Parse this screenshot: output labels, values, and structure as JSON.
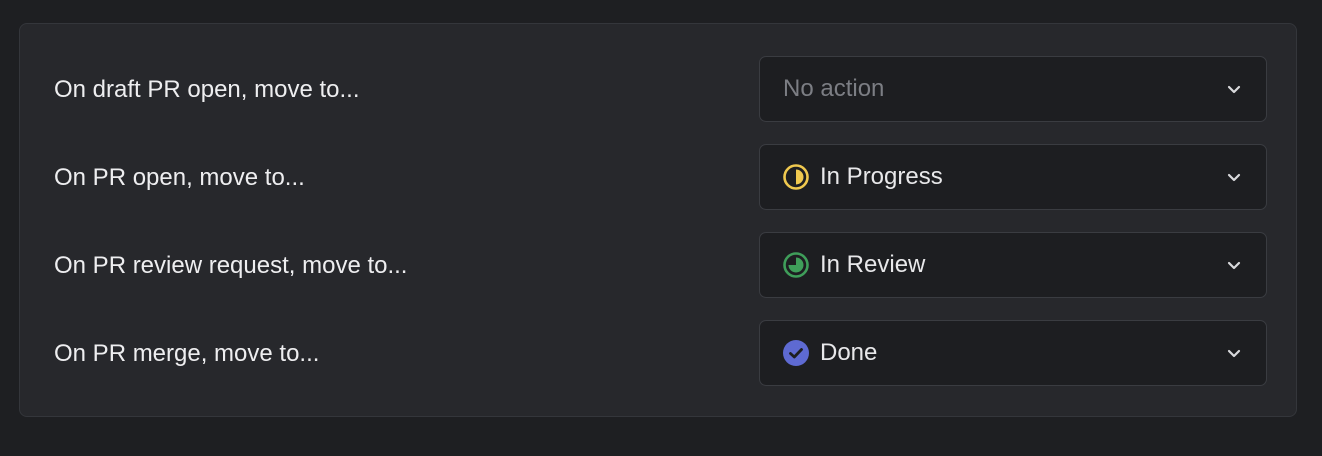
{
  "rules": [
    {
      "label": "On draft PR open, move to...",
      "value": "No action",
      "placeholder": true,
      "icon": "none"
    },
    {
      "label": "On PR open, move to...",
      "value": "In Progress",
      "placeholder": false,
      "icon": "in-progress-icon",
      "icon_color": "#f0c94f"
    },
    {
      "label": "On PR review request, move to...",
      "value": "In Review",
      "placeholder": false,
      "icon": "in-review-icon",
      "icon_color": "#3f9e5a"
    },
    {
      "label": "On PR merge, move to...",
      "value": "Done",
      "placeholder": false,
      "icon": "done-icon",
      "icon_color": "#5e6ad2"
    }
  ],
  "colors": {
    "background": "#1e1f22",
    "panel": "#27282c",
    "select_bg": "#1d1e21",
    "text": "#eeeef0",
    "placeholder": "#7c7e84"
  }
}
